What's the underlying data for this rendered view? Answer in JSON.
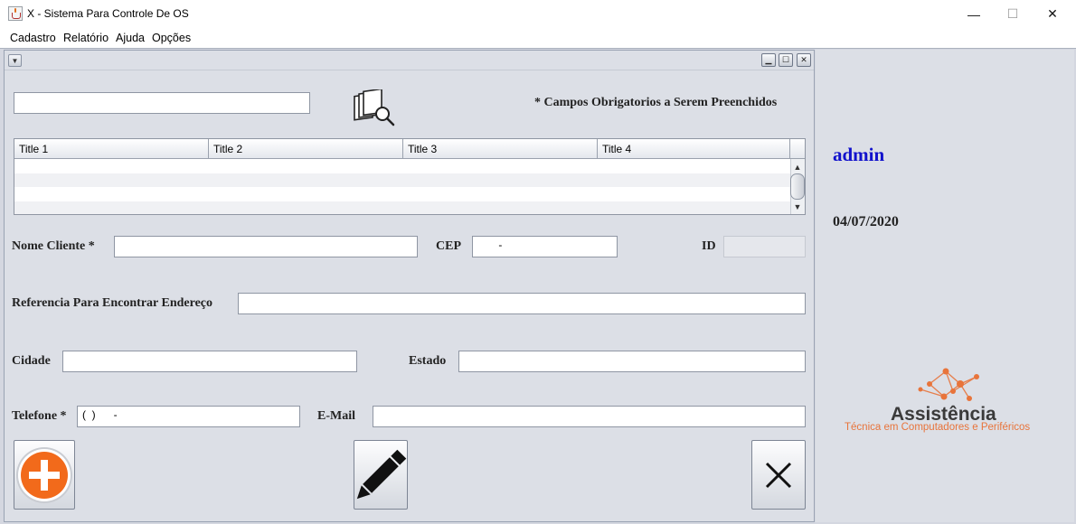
{
  "window": {
    "title": "X - Sistema Para Controle De OS",
    "controls": {
      "minimize": "—",
      "maximize": "☐",
      "close": "✕"
    }
  },
  "menubar": [
    "Cadastro",
    "Relatório",
    "Ajuda",
    "Opções"
  ],
  "internal_frame": {
    "menu_glyph": "▼",
    "controls": {
      "minimize": "▁",
      "maximize": "☐",
      "close": "✕"
    }
  },
  "search": {
    "value": ""
  },
  "required_note": "* Campos Obrigatorios a Serem Preenchidos",
  "table": {
    "columns": [
      "Title 1",
      "Title 2",
      "Title 3",
      "Title 4"
    ],
    "rows": [],
    "scroll_up": "▲",
    "scroll_down": "▼"
  },
  "form": {
    "nome_label": "Nome Cliente *",
    "nome_value": "",
    "cep_label": "CEP",
    "cep_value": "       -",
    "id_label": "ID",
    "id_value": "",
    "referencia_label": "Referencia  Para  Encontrar  Endereço",
    "referencia_value": "",
    "cidade_label": "Cidade",
    "cidade_value": "",
    "estado_label": "Estado",
    "estado_value": "",
    "telefone_label": "Telefone *",
    "telefone_value": "(  )      -",
    "email_label": "E-Mail",
    "email_value": ""
  },
  "icons": {
    "search": "search-documents-icon",
    "add": "add-icon",
    "edit": "pencil-icon",
    "delete": "close-icon"
  },
  "sidebar": {
    "username": "admin",
    "date": "04/07/2020",
    "logo_title": "Assistência",
    "logo_subtitle": "Técnica em Computadores e Periféricos"
  },
  "colors": {
    "username": "#1212cc",
    "logo_accent": "#e8743b",
    "add_button": "#f26a1b"
  }
}
